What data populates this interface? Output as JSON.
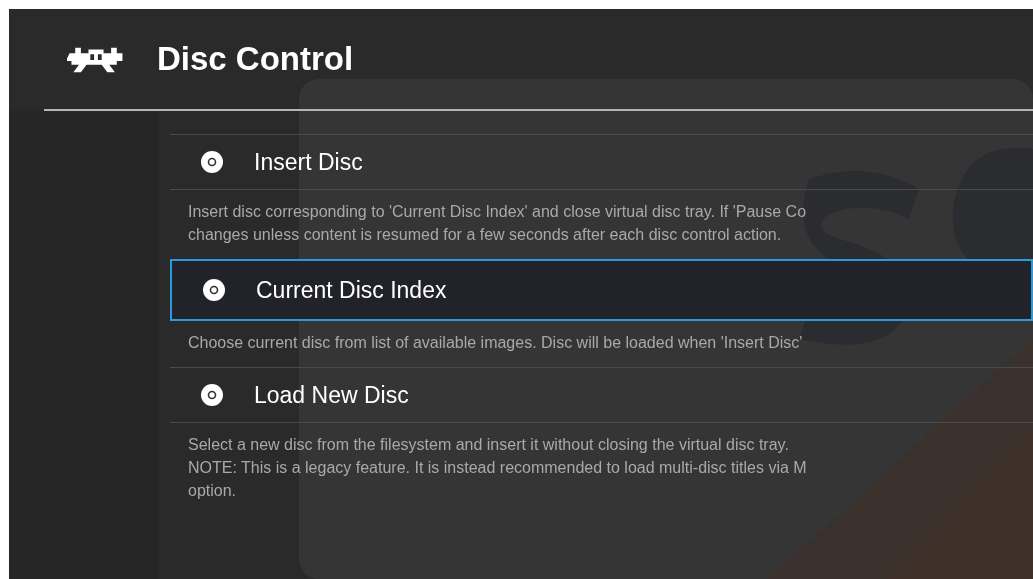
{
  "header": {
    "title": "Disc Control"
  },
  "items": [
    {
      "label": "Insert Disc",
      "selected": false,
      "description": [
        "Insert disc corresponding to 'Current Disc Index' and close virtual disc tray. If 'Pause Co",
        "changes unless content is resumed for a few seconds after each disc control action."
      ]
    },
    {
      "label": "Current Disc Index",
      "selected": true,
      "description": [
        "Choose current disc from list of available images. Disc will be loaded when 'Insert Disc'"
      ]
    },
    {
      "label": "Load New Disc",
      "selected": false,
      "description": [
        "Select a new disc from the filesystem and insert it without closing the virtual disc tray.",
        "NOTE: This is a legacy feature. It is instead recommended to load multi-disc titles via M",
        "option."
      ]
    }
  ]
}
